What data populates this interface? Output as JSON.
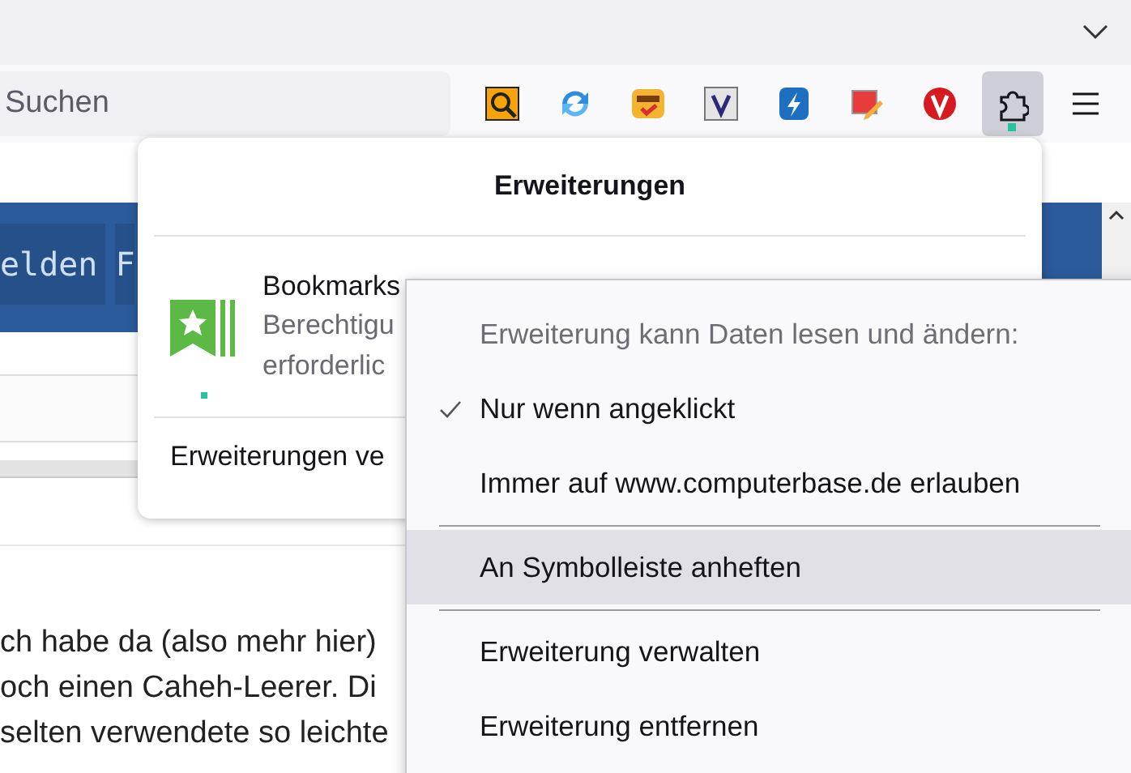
{
  "toolbar": {
    "search": {
      "placeholder": "Suchen"
    },
    "extensions_button": {
      "selected": true
    }
  },
  "page": {
    "nav_tabs": [
      "elden",
      "F"
    ],
    "article_lines": [
      "ch habe da (also mehr hier)",
      "och einen Caheh-Leerer. Di",
      "selten verwendete so leichte"
    ]
  },
  "extensions_panel": {
    "title": "Erweiterungen",
    "extension": {
      "name": "Bookmarks",
      "description_lines": [
        "Berechtigu",
        "erforderlic"
      ]
    },
    "footer": "Erweiterungen ve"
  },
  "context_menu": {
    "items": [
      {
        "kind": "header",
        "label": "Erweiterung kann Daten lesen und ändern:"
      },
      {
        "kind": "option",
        "label": "Nur wenn angeklickt",
        "checked": true
      },
      {
        "kind": "option",
        "label": "Immer auf www.computerbase.de erlauben",
        "checked": false
      },
      {
        "kind": "separator"
      },
      {
        "kind": "action",
        "label": "An Symbolleiste anheften",
        "selected": true
      },
      {
        "kind": "separator"
      },
      {
        "kind": "action",
        "label": "Erweiterung verwalten",
        "selected": false
      },
      {
        "kind": "action",
        "label": "Erweiterung entfernen",
        "selected": false
      }
    ]
  }
}
